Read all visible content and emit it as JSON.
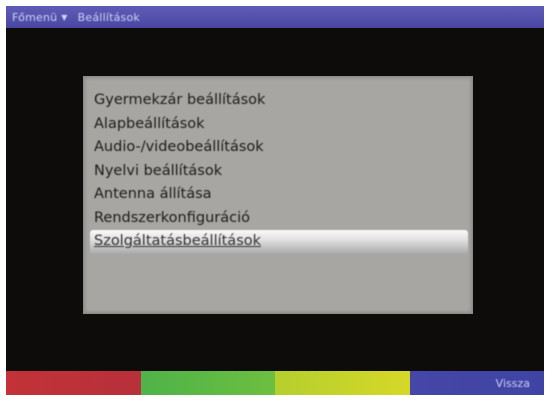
{
  "header": {
    "crumb_1": "Főmenü",
    "separator": "▼",
    "crumb_2": "Beállítások"
  },
  "menu": {
    "items": [
      {
        "label": "Gyermekzár beállítások"
      },
      {
        "label": "Alapbeállítások"
      },
      {
        "label": "Audio-/videobeállítások"
      },
      {
        "label": "Nyelvi beállítások"
      },
      {
        "label": "Antenna állítása"
      },
      {
        "label": "Rendszerkonfiguráció"
      },
      {
        "label": "Szolgáltatásbeállítások"
      }
    ],
    "selected_index": 6
  },
  "color_keys": {
    "red": {
      "color": "#c23238",
      "label": ""
    },
    "green": {
      "color": "#5cb845",
      "label": ""
    },
    "yellow": {
      "color": "#c9d42a",
      "label": ""
    },
    "blue": {
      "color": "#4446a8",
      "label": "Vissza"
    }
  }
}
